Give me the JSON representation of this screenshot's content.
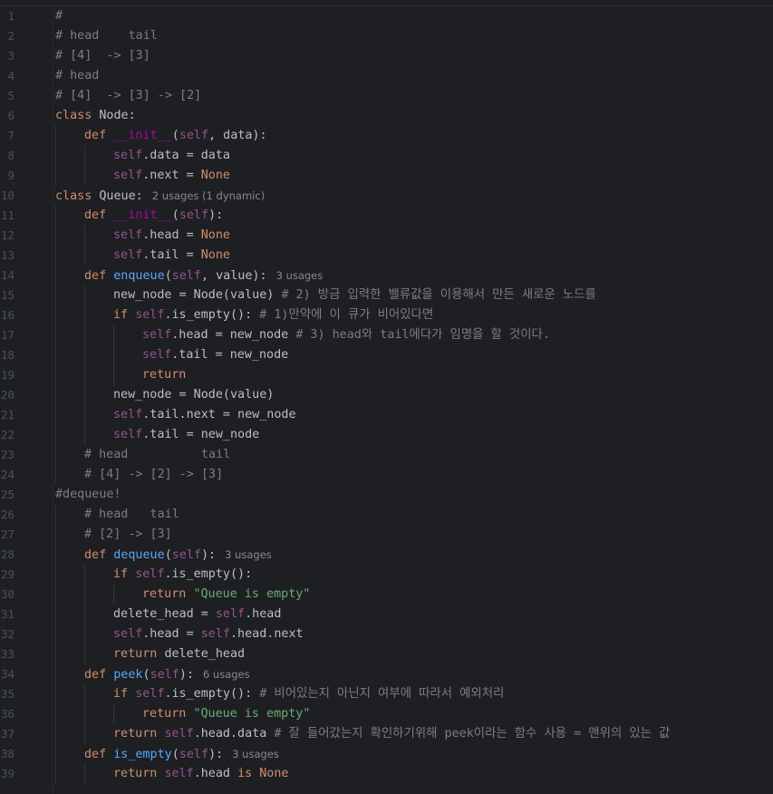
{
  "editor": {
    "language": "python",
    "lines": [
      {
        "n": "1",
        "indent": 0,
        "tokens": [
          {
            "t": "#",
            "c": "cmt"
          }
        ]
      },
      {
        "n": "2",
        "indent": 0,
        "tokens": [
          {
            "t": "# head    tail",
            "c": "cmt"
          }
        ]
      },
      {
        "n": "3",
        "indent": 0,
        "tokens": [
          {
            "t": "# [4]  -> [3]",
            "c": "cmt"
          }
        ]
      },
      {
        "n": "4",
        "indent": 0,
        "tokens": [
          {
            "t": "# head",
            "c": "cmt"
          }
        ]
      },
      {
        "n": "5",
        "indent": 0,
        "tokens": [
          {
            "t": "# [4]  -> [3] -> [2]",
            "c": "cmt"
          }
        ]
      },
      {
        "n": "6",
        "indent": 0,
        "tokens": [
          {
            "t": "class ",
            "c": "kw"
          },
          {
            "t": "Node:",
            "c": "plain"
          }
        ]
      },
      {
        "n": "7",
        "indent": 1,
        "tokens": [
          {
            "t": "def ",
            "c": "kw"
          },
          {
            "t": "__init__",
            "c": "dun"
          },
          {
            "t": "(",
            "c": "plain"
          },
          {
            "t": "self",
            "c": "self"
          },
          {
            "t": ", data):",
            "c": "plain"
          }
        ]
      },
      {
        "n": "8",
        "indent": 2,
        "tokens": [
          {
            "t": "self",
            "c": "self"
          },
          {
            "t": ".data = data",
            "c": "plain"
          }
        ]
      },
      {
        "n": "9",
        "indent": 2,
        "tokens": [
          {
            "t": "self",
            "c": "self"
          },
          {
            "t": ".next = ",
            "c": "plain"
          },
          {
            "t": "None",
            "c": "none"
          }
        ]
      },
      {
        "n": "10",
        "indent": 0,
        "tokens": [
          {
            "t": "class ",
            "c": "kw"
          },
          {
            "t": "Queue:",
            "c": "plain"
          }
        ],
        "hint": "2 usages (1 dynamic)"
      },
      {
        "n": "11",
        "indent": 1,
        "tokens": [
          {
            "t": "def ",
            "c": "kw"
          },
          {
            "t": "__init__",
            "c": "dun"
          },
          {
            "t": "(",
            "c": "plain"
          },
          {
            "t": "self",
            "c": "self"
          },
          {
            "t": "):",
            "c": "plain"
          }
        ]
      },
      {
        "n": "12",
        "indent": 2,
        "tokens": [
          {
            "t": "self",
            "c": "self"
          },
          {
            "t": ".head = ",
            "c": "plain"
          },
          {
            "t": "None",
            "c": "none"
          }
        ]
      },
      {
        "n": "13",
        "indent": 2,
        "tokens": [
          {
            "t": "self",
            "c": "self"
          },
          {
            "t": ".tail = ",
            "c": "plain"
          },
          {
            "t": "None",
            "c": "none"
          }
        ]
      },
      {
        "n": "14",
        "indent": 1,
        "tokens": [
          {
            "t": "def ",
            "c": "kw"
          },
          {
            "t": "enqueue",
            "c": "fn"
          },
          {
            "t": "(",
            "c": "plain"
          },
          {
            "t": "self",
            "c": "self"
          },
          {
            "t": ", value):",
            "c": "plain"
          }
        ],
        "hint": "3 usages"
      },
      {
        "n": "15",
        "indent": 2,
        "tokens": [
          {
            "t": "new_node = Node(value) ",
            "c": "plain"
          },
          {
            "t": "# 2) 방금 입력한 밸류값을 이용해서 만든 새로운 노드를",
            "c": "cmt"
          }
        ]
      },
      {
        "n": "16",
        "indent": 2,
        "tokens": [
          {
            "t": "if ",
            "c": "kw"
          },
          {
            "t": "self",
            "c": "self"
          },
          {
            "t": ".is_empty(): ",
            "c": "plain"
          },
          {
            "t": "# 1)만약에 이 큐가 비어있다면",
            "c": "cmt"
          }
        ]
      },
      {
        "n": "17",
        "indent": 3,
        "tokens": [
          {
            "t": "self",
            "c": "self"
          },
          {
            "t": ".head = new_node ",
            "c": "plain"
          },
          {
            "t": "# 3) head와 tail에다가 임명을 할 것이다.",
            "c": "cmt"
          }
        ]
      },
      {
        "n": "18",
        "indent": 3,
        "tokens": [
          {
            "t": "self",
            "c": "self"
          },
          {
            "t": ".tail = new_node",
            "c": "plain"
          }
        ]
      },
      {
        "n": "19",
        "indent": 3,
        "tokens": [
          {
            "t": "return",
            "c": "kw"
          }
        ]
      },
      {
        "n": "20",
        "indent": 2,
        "tokens": [
          {
            "t": "new_node = Node(value)",
            "c": "plain"
          }
        ]
      },
      {
        "n": "21",
        "indent": 2,
        "tokens": [
          {
            "t": "self",
            "c": "self"
          },
          {
            "t": ".tail.next = new_node",
            "c": "plain"
          }
        ]
      },
      {
        "n": "22",
        "indent": 2,
        "tokens": [
          {
            "t": "self",
            "c": "self"
          },
          {
            "t": ".tail = new_node",
            "c": "plain"
          }
        ]
      },
      {
        "n": "23",
        "indent": 1,
        "tokens": [
          {
            "t": "# head          tail",
            "c": "cmt"
          }
        ]
      },
      {
        "n": "24",
        "indent": 1,
        "tokens": [
          {
            "t": "# [4] -> [2] -> [3]",
            "c": "cmt"
          }
        ]
      },
      {
        "n": "25",
        "indent": 0,
        "tokens": [
          {
            "t": "#dequeue!",
            "c": "cmt"
          }
        ]
      },
      {
        "n": "26",
        "indent": 1,
        "tokens": [
          {
            "t": "# head   tail",
            "c": "cmt"
          }
        ]
      },
      {
        "n": "27",
        "indent": 1,
        "tokens": [
          {
            "t": "# [2] -> [3]",
            "c": "cmt"
          }
        ]
      },
      {
        "n": "28",
        "indent": 1,
        "tokens": [
          {
            "t": "def ",
            "c": "kw"
          },
          {
            "t": "dequeue",
            "c": "fn"
          },
          {
            "t": "(",
            "c": "plain"
          },
          {
            "t": "self",
            "c": "self"
          },
          {
            "t": "):",
            "c": "plain"
          }
        ],
        "hint": "3 usages"
      },
      {
        "n": "29",
        "indent": 2,
        "tokens": [
          {
            "t": "if ",
            "c": "kw"
          },
          {
            "t": "self",
            "c": "self"
          },
          {
            "t": ".is_empty():",
            "c": "plain"
          }
        ]
      },
      {
        "n": "30",
        "indent": 3,
        "tokens": [
          {
            "t": "return ",
            "c": "kw"
          },
          {
            "t": "\"Queue is empty\"",
            "c": "str"
          }
        ]
      },
      {
        "n": "31",
        "indent": 2,
        "tokens": [
          {
            "t": "delete_head = ",
            "c": "plain"
          },
          {
            "t": "self",
            "c": "self"
          },
          {
            "t": ".head",
            "c": "plain"
          }
        ]
      },
      {
        "n": "32",
        "indent": 2,
        "tokens": [
          {
            "t": "self",
            "c": "self"
          },
          {
            "t": ".head = ",
            "c": "plain"
          },
          {
            "t": "self",
            "c": "self"
          },
          {
            "t": ".head.next",
            "c": "plain"
          }
        ]
      },
      {
        "n": "33",
        "indent": 2,
        "tokens": [
          {
            "t": "return ",
            "c": "kw"
          },
          {
            "t": "delete_head",
            "c": "plain"
          }
        ]
      },
      {
        "n": "34",
        "indent": 1,
        "tokens": [
          {
            "t": "def ",
            "c": "kw"
          },
          {
            "t": "peek",
            "c": "fn"
          },
          {
            "t": "(",
            "c": "plain"
          },
          {
            "t": "self",
            "c": "self"
          },
          {
            "t": "):",
            "c": "plain"
          }
        ],
        "hint": "6 usages"
      },
      {
        "n": "35",
        "indent": 2,
        "tokens": [
          {
            "t": "if ",
            "c": "kw"
          },
          {
            "t": "self",
            "c": "self"
          },
          {
            "t": ".is_empty(): ",
            "c": "plain"
          },
          {
            "t": "# 비어있는지 아닌지 여부에 따라서 예외처리",
            "c": "cmt"
          }
        ]
      },
      {
        "n": "36",
        "indent": 3,
        "tokens": [
          {
            "t": "return ",
            "c": "kw"
          },
          {
            "t": "\"Queue is empty\"",
            "c": "str"
          }
        ]
      },
      {
        "n": "37",
        "indent": 2,
        "tokens": [
          {
            "t": "return ",
            "c": "kw"
          },
          {
            "t": "self",
            "c": "self"
          },
          {
            "t": ".head.data ",
            "c": "plain"
          },
          {
            "t": "# 잘 들어갔는지 확인하기위해 peek이라는 함수 사용 = 맨위의 있는 값",
            "c": "cmt"
          }
        ]
      },
      {
        "n": "38",
        "indent": 1,
        "tokens": [
          {
            "t": "def ",
            "c": "kw"
          },
          {
            "t": "is_empty",
            "c": "fn"
          },
          {
            "t": "(",
            "c": "plain"
          },
          {
            "t": "self",
            "c": "self"
          },
          {
            "t": "):",
            "c": "plain"
          }
        ],
        "hint": "3 usages"
      },
      {
        "n": "39",
        "indent": 2,
        "tokens": [
          {
            "t": "return ",
            "c": "kw"
          },
          {
            "t": "self",
            "c": "self"
          },
          {
            "t": ".head ",
            "c": "plain"
          },
          {
            "t": "is ",
            "c": "kw"
          },
          {
            "t": "None",
            "c": "none"
          }
        ]
      }
    ]
  }
}
